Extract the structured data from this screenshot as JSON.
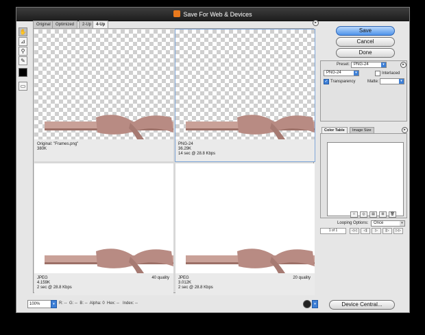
{
  "window": {
    "title": "Save For Web & Devices"
  },
  "tabs": [
    "Original",
    "Optimized",
    "2-Up",
    "4-Up"
  ],
  "active_tab": "4-Up",
  "panes": [
    {
      "line1": "Original: \"Frames.png\"",
      "line2": "380K",
      "line3": "",
      "quality": ""
    },
    {
      "line1": "PNG-24",
      "line2": "36.29K",
      "line3": "14 sec @ 28.8 Kbps",
      "quality": ""
    },
    {
      "line1": "JPEG",
      "line2": "4.159K",
      "line3": "2 sec @ 28.8 Kbps",
      "quality": "40 quality"
    },
    {
      "line1": "JPEG",
      "line2": "3.012K",
      "line3": "2 sec @ 28.8 Kbps",
      "quality": "20 quality"
    }
  ],
  "buttons": {
    "save": "Save",
    "cancel": "Cancel",
    "done": "Done",
    "device_central": "Device Central..."
  },
  "settings": {
    "preset_label": "Preset:",
    "preset_value": "PNG-24",
    "format_value": "PNG-24",
    "interlaced_label": "Interlaced",
    "interlaced_checked": false,
    "transparency_label": "Transparency",
    "transparency_checked": true,
    "matte_label": "Matte:"
  },
  "color_panel": {
    "tabs": [
      "Color Table",
      "Image Size"
    ],
    "active_tab": "Color Table"
  },
  "animation": {
    "looping_label": "Looping Options:",
    "looping_value": "Once",
    "frame_counter": "1 of 1"
  },
  "status": {
    "zoom": "100%",
    "readout": "R: --  G: --  B: --  Alpha: 0  Hex: --   Index: --"
  },
  "tools": [
    "hand-tool",
    "slice-select-tool",
    "zoom-tool",
    "eyedropper-tool"
  ],
  "colors": {
    "accent": "#3d7fd6",
    "ribbon": "#c9a198",
    "checker": "#cfcfcf"
  }
}
